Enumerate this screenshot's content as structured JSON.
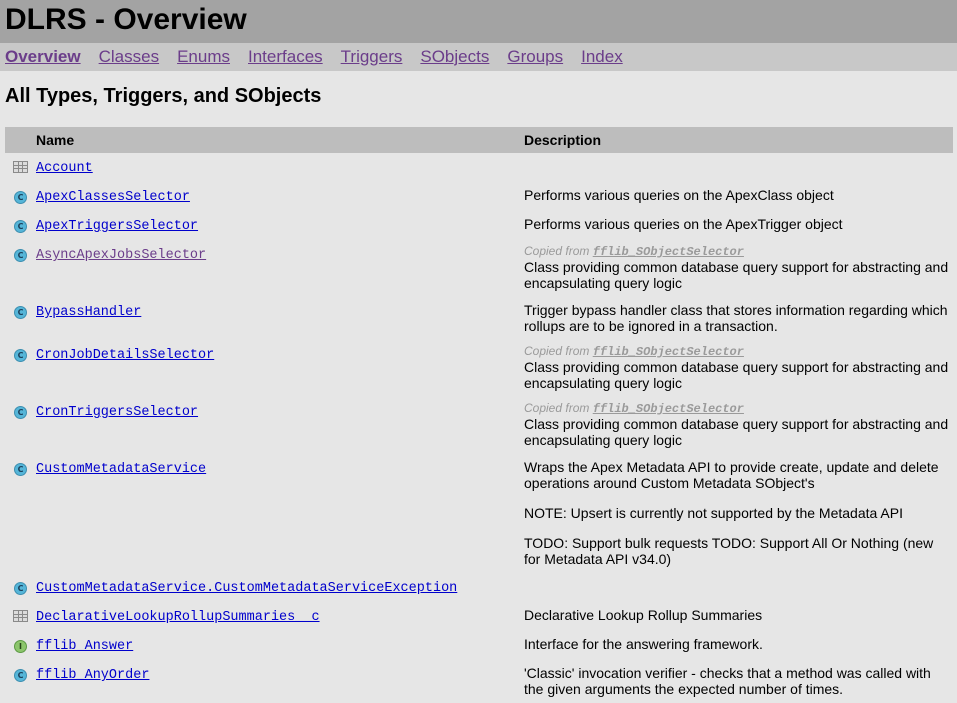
{
  "header": {
    "title": "DLRS - Overview"
  },
  "nav": {
    "items": [
      {
        "label": "Overview"
      },
      {
        "label": "Classes"
      },
      {
        "label": "Enums"
      },
      {
        "label": "Interfaces"
      },
      {
        "label": "Triggers"
      },
      {
        "label": "SObjects"
      },
      {
        "label": "Groups"
      },
      {
        "label": "Index"
      }
    ]
  },
  "main": {
    "heading": "All Types, Triggers, and SObjects",
    "columns": {
      "name": "Name",
      "description": "Description"
    },
    "copied_from_label": "Copied from",
    "copied_from_source": "fflib_SObjectSelector",
    "rows": [
      {
        "name": "Account",
        "icon": "table-icon"
      },
      {
        "name": "ApexClassesSelector",
        "icon": "class-icon",
        "desc": [
          "Performs various queries on the ApexClass object"
        ]
      },
      {
        "name": "ApexTriggersSelector",
        "icon": "class-icon",
        "desc": [
          "Performs various queries on the ApexTrigger object"
        ]
      },
      {
        "name": "AsyncApexJobsSelector",
        "icon": "class-icon",
        "copied": true,
        "desc": [
          "Class providing common database query support for abstracting and encapsulating query logic"
        ]
      },
      {
        "name": "BypassHandler",
        "icon": "class-icon",
        "desc": [
          "Trigger bypass handler class that stores information regarding which rollups are to be ignored in a transaction."
        ]
      },
      {
        "name": "CronJobDetailsSelector",
        "icon": "class-icon",
        "copied": true,
        "desc": [
          "Class providing common database query support for abstracting and encapsulating query logic"
        ]
      },
      {
        "name": "CronTriggersSelector",
        "icon": "class-icon",
        "copied": true,
        "desc": [
          "Class providing common database query support for abstracting and encapsulating query logic"
        ]
      },
      {
        "name": "CustomMetadataService",
        "icon": "class-icon",
        "desc": [
          "Wraps the Apex Metadata API to provide create, update and delete operations around Custom Metadata SObject's",
          "NOTE: Upsert is currently not supported by the Metadata API",
          "TODO: Support bulk requests TODO: Support All Or Nothing (new for Metadata API v34.0)"
        ]
      },
      {
        "name": "CustomMetadataService.CustomMetadataServiceException",
        "icon": "class-icon"
      },
      {
        "name": "DeclarativeLookupRollupSummaries__c",
        "icon": "table-icon",
        "desc": [
          "Declarative Lookup Rollup Summaries"
        ]
      },
      {
        "name": "fflib_Answer",
        "icon": "interface-icon",
        "desc": [
          "Interface for the answering framework."
        ]
      },
      {
        "name": "fflib_AnyOrder",
        "icon": "class-icon",
        "desc": [
          "'Classic' invocation verifier - checks that a method was called with the given arguments the expected number of times."
        ]
      }
    ]
  }
}
